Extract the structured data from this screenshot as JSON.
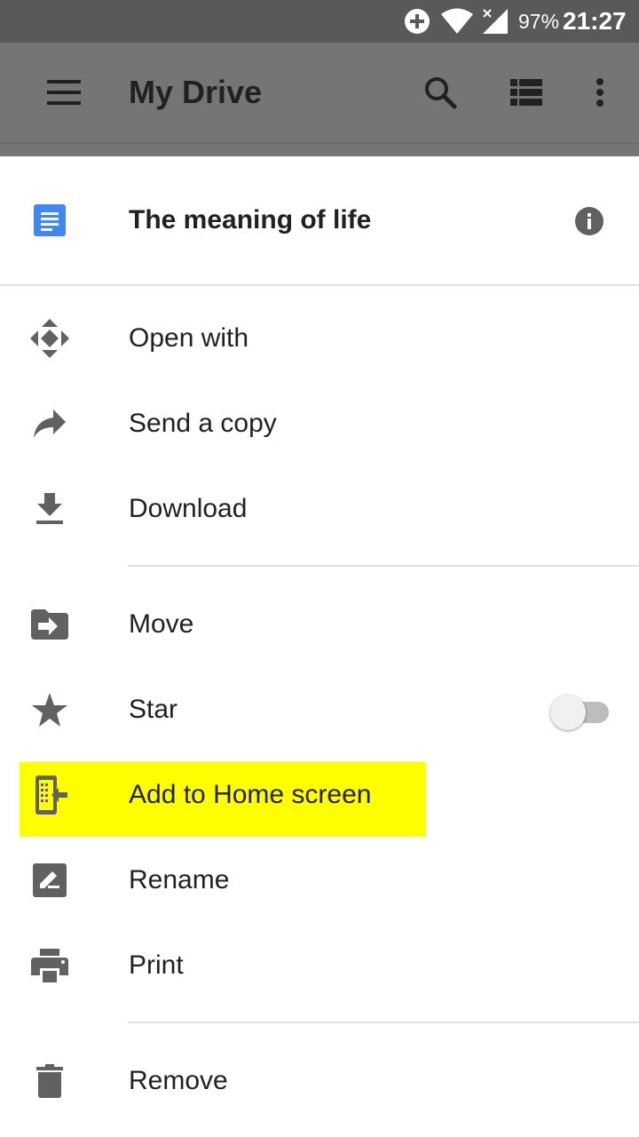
{
  "status_bar": {
    "battery": "97%",
    "time": "21:27",
    "icons": [
      "data-saver-icon",
      "wifi-icon",
      "signal-icon"
    ]
  },
  "app_bar": {
    "title": "My Drive",
    "icons": [
      "menu-icon",
      "search-icon",
      "list-view-icon",
      "more-vert-icon"
    ]
  },
  "sheet": {
    "file_title": "The meaning of life",
    "items": [
      {
        "label": "Open with",
        "icon": "open-with-icon"
      },
      {
        "label": "Send a copy",
        "icon": "share-arrow-icon"
      },
      {
        "label": "Download",
        "icon": "download-icon"
      },
      {
        "label": "Move",
        "icon": "move-folder-icon"
      },
      {
        "label": "Star",
        "icon": "star-icon",
        "toggle_on": false
      },
      {
        "label": "Add to Home screen",
        "icon": "add-to-home-icon",
        "highlighted": true
      },
      {
        "label": "Rename",
        "icon": "rename-icon"
      },
      {
        "label": "Print",
        "icon": "print-icon"
      },
      {
        "label": "Remove",
        "icon": "trash-icon"
      }
    ]
  },
  "colors": {
    "status_bar": "#595959",
    "app_bar_dimmed": "#757575",
    "icon_gray": "#616161",
    "doc_blue": "#4285f4",
    "highlight": "#ffff00"
  }
}
